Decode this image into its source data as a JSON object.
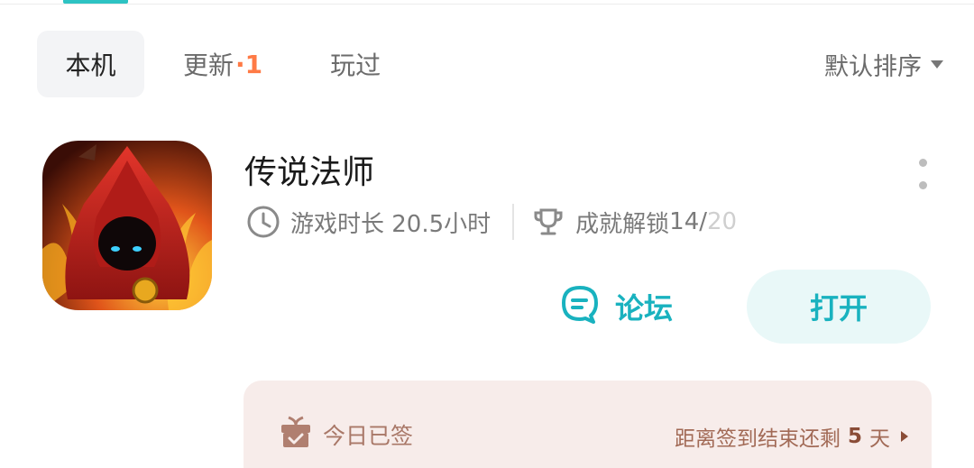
{
  "tabs": {
    "local": "本机",
    "update": "更新",
    "update_dot": "·",
    "update_count": "1",
    "played": "玩过"
  },
  "sort": {
    "label": "默认排序"
  },
  "game": {
    "title": "传说法师",
    "playtime": "游戏时长 20.5小时",
    "achievement_label": "成就解锁 ",
    "achievement_unlocked": "14/",
    "achievement_total": "20"
  },
  "actions": {
    "forum": "论坛",
    "open": "打开"
  },
  "signin": {
    "status": "今日已签",
    "countdown_prefix": "距离签到结束还剩",
    "countdown_days": "5",
    "countdown_suffix": "天"
  },
  "colors": {
    "accent": "#19b2bf",
    "badge": "#ff7a45",
    "signin_bg": "#f7ecea"
  },
  "icons": [
    "clock-icon",
    "trophy-icon",
    "forum-chat-icon",
    "gift-check-icon",
    "more-vertical-icon",
    "caret-down-icon",
    "chevron-right-icon"
  ]
}
